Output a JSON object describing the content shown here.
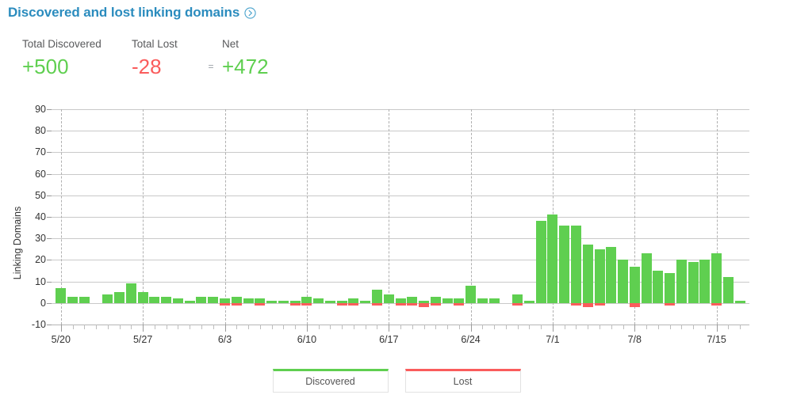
{
  "header": {
    "title": "Discovered and lost linking domains",
    "expand_icon": "chevron-right-circle-icon"
  },
  "summary": {
    "discovered_label": "Total Discovered",
    "discovered_value": "+500",
    "lost_label": "Total Lost",
    "lost_value": "-28",
    "equals_sign": "=",
    "net_label": "Net",
    "net_value": "+472"
  },
  "legend": {
    "discovered": "Discovered",
    "lost": "Lost"
  },
  "colors": {
    "discovered": "#5fcf50",
    "lost": "#fa5c5c",
    "title": "#2b8cbe",
    "grid": "#c9c9c9"
  },
  "chart_data": {
    "type": "bar",
    "title": "Discovered and lost linking domains",
    "xlabel": "",
    "ylabel": "Linking Domains",
    "ylim": [
      -10,
      90
    ],
    "yticks": [
      90,
      80,
      70,
      60,
      50,
      40,
      30,
      20,
      10,
      0,
      -10
    ],
    "grid": true,
    "legend_position": "bottom",
    "stacked": true,
    "x_tick_labels": [
      "5/20",
      "5/27",
      "6/3",
      "6/10",
      "6/17",
      "6/24",
      "7/1",
      "7/8",
      "7/15"
    ],
    "x_tick_label_indices": [
      0,
      7,
      14,
      21,
      28,
      35,
      42,
      49,
      56
    ],
    "categories": [
      "5/20",
      "5/21",
      "5/22",
      "5/23",
      "5/24",
      "5/25",
      "5/26",
      "5/27",
      "5/28",
      "5/29",
      "5/30",
      "5/31",
      "6/1",
      "6/2",
      "6/3",
      "6/4",
      "6/5",
      "6/6",
      "6/7",
      "6/8",
      "6/9",
      "6/10",
      "6/11",
      "6/12",
      "6/13",
      "6/14",
      "6/15",
      "6/16",
      "6/17",
      "6/18",
      "6/19",
      "6/20",
      "6/21",
      "6/22",
      "6/23",
      "6/24",
      "6/25",
      "6/26",
      "6/27",
      "6/28",
      "6/29",
      "6/30",
      "7/1",
      "7/2",
      "7/3",
      "7/4",
      "7/5",
      "7/6",
      "7/7",
      "7/8",
      "7/9",
      "7/10",
      "7/11",
      "7/12",
      "7/13",
      "7/14",
      "7/15",
      "7/16",
      "7/17"
    ],
    "series": [
      {
        "name": "Discovered",
        "color": "#5fcf50",
        "values": [
          7,
          3,
          3,
          0,
          4,
          5,
          9,
          5,
          3,
          3,
          2,
          1,
          3,
          3,
          2,
          3,
          2,
          2,
          1,
          1,
          1,
          3,
          2,
          1,
          1,
          2,
          1,
          6,
          4,
          2,
          3,
          1,
          3,
          2,
          2,
          8,
          2,
          2,
          0,
          4,
          1,
          38,
          41,
          36,
          36,
          27,
          25,
          26,
          20,
          17,
          23,
          15,
          14,
          20,
          19,
          20,
          23,
          12,
          1
        ]
      },
      {
        "name": "Lost",
        "color": "#fa5c5c",
        "values": [
          0,
          0,
          0,
          0,
          0,
          0,
          0,
          0,
          0,
          0,
          0,
          0,
          0,
          0,
          -1,
          -1,
          0,
          -1,
          0,
          0,
          -1,
          -1,
          0,
          0,
          -1,
          -1,
          0,
          -1,
          0,
          -1,
          -1,
          -2,
          -1,
          0,
          -1,
          0,
          0,
          0,
          0,
          -1,
          0,
          0,
          0,
          0,
          -1,
          -2,
          -1,
          0,
          0,
          -2,
          0,
          0,
          -1,
          0,
          0,
          0,
          -1,
          0,
          0
        ]
      }
    ]
  }
}
